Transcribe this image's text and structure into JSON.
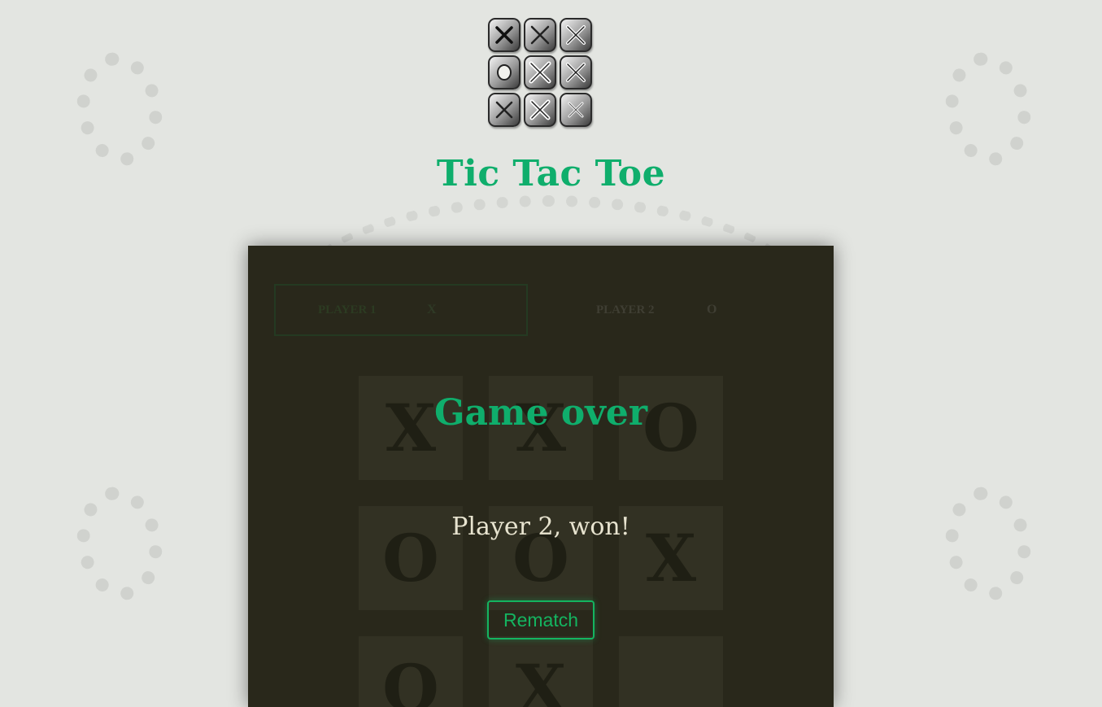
{
  "app": {
    "title": "Tic Tac Toe"
  },
  "logo": {
    "tiles": [
      "x-tile-icon",
      "x-tile-icon",
      "x-tile-icon",
      "o-tile-icon",
      "x-tile-icon",
      "x-tile-icon",
      "x-tile-icon",
      "x-tile-icon",
      "x-tile-icon"
    ]
  },
  "scoreboard": {
    "player1": {
      "name": "PLAYER 1",
      "mark": "X",
      "score": ""
    },
    "player2": {
      "name": "PLAYER 2",
      "mark": "O",
      "score": ""
    }
  },
  "board": {
    "cells": [
      "X",
      "X",
      "O",
      "O",
      "O",
      "X",
      "O",
      "X",
      ""
    ]
  },
  "overlay": {
    "title": "Game over",
    "result": "Player 2, won!",
    "rematch_label": "Rematch"
  },
  "colors": {
    "accent": "#0fae6c",
    "button_border": "#14b460",
    "panel_bg": "#29281b",
    "page_bg": "#e3e5e1",
    "cell_bg": "#323123",
    "result_text": "#e7e3cf"
  }
}
